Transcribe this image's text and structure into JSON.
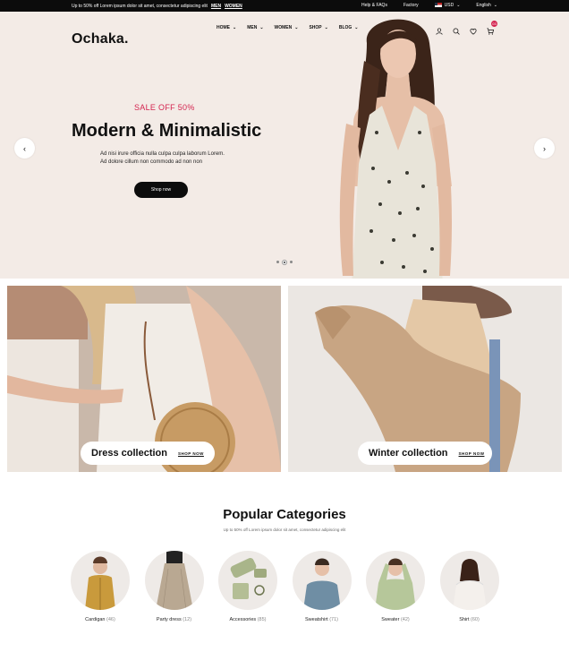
{
  "topbar": {
    "promo_text": "Up to 50% off Lorem ipsum dolor sit amet, consectetur adipiscing elit",
    "promo_link_men": "MEN",
    "promo_link_women": "WOMEN",
    "help": "Help & FAQs",
    "factory": "Factory",
    "currency": "USD",
    "language": "English"
  },
  "header": {
    "logo": "Ochaka.",
    "nav": [
      {
        "label": "HOME"
      },
      {
        "label": "MEN"
      },
      {
        "label": "WOMEN"
      },
      {
        "label": "SHOP"
      },
      {
        "label": "BLOG"
      }
    ],
    "cart_count": "03",
    "icons": [
      "user-icon",
      "search-icon",
      "heart-icon",
      "cart-icon"
    ]
  },
  "hero": {
    "sale": "SALE OFF 50%",
    "headline": "Modern & Minimalistic",
    "sub_line1": "Ad nisi irure officia nulla culpa culpa laborum Lorem.",
    "sub_line2": "Ad dolore cillum non commodo ad non non",
    "button": "Shop now",
    "slides": 3,
    "active_slide": 2
  },
  "collections": [
    {
      "name": "Dress collection",
      "link": "SHOP NOW"
    },
    {
      "name": "Winter collection",
      "link": "SHOP NOW"
    }
  ],
  "popular": {
    "title": "Popular Categories",
    "subtitle": "Up to 50% off Lorem ipsum dolor sit amet, consectetur adipiscing elit",
    "categories": [
      {
        "name": "Cardigan",
        "count": "(46)"
      },
      {
        "name": "Party dress",
        "count": "(12)"
      },
      {
        "name": "Accessories",
        "count": "(85)"
      },
      {
        "name": "Sweatshirt",
        "count": "(71)"
      },
      {
        "name": "Sweater",
        "count": "(42)"
      },
      {
        "name": "Shirt",
        "count": "(60)"
      }
    ]
  },
  "colors": {
    "accent": "#d4234f",
    "dark": "#0c0c0c",
    "hero_bg": "#f3ebe6"
  }
}
